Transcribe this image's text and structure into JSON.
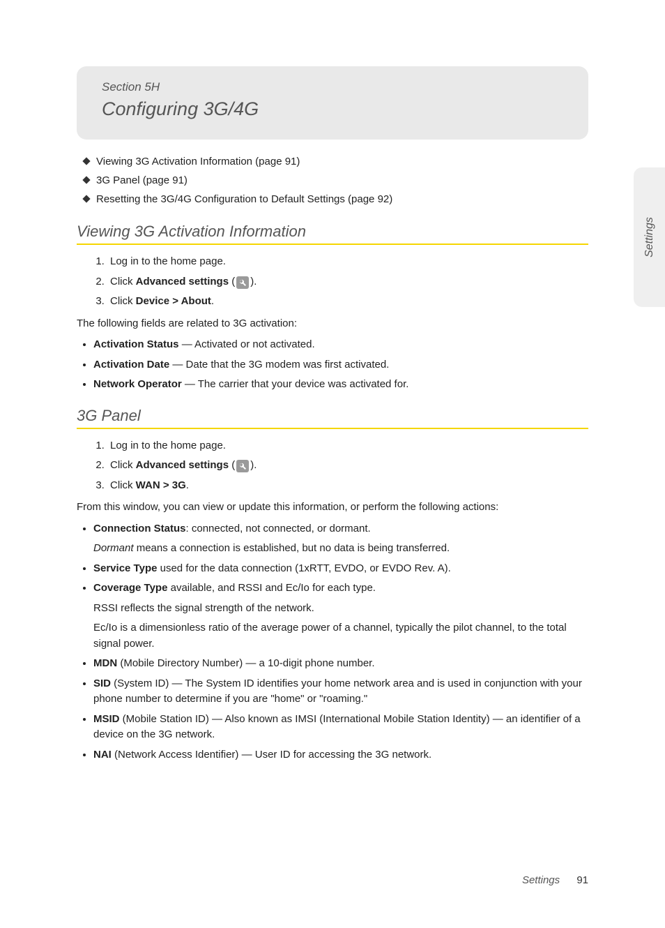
{
  "sideTab": "Settings",
  "header": {
    "sectionLabel": "Section 5H",
    "title": "Configuring 3G/4G"
  },
  "toc": [
    "Viewing 3G Activation Information (page 91)",
    "3G Panel (page 91)",
    "Resetting the 3G/4G Configuration to Default Settings (page 92)"
  ],
  "sectionA": {
    "heading": "Viewing 3G Activation Information",
    "steps": {
      "s1": "Log in to the home page.",
      "s2_prefix": "Click ",
      "s2_bold": "Advanced settings",
      "s2_paren_open": " (",
      "s2_paren_close": ").",
      "s3_prefix": "Click ",
      "s3_bold": "Device > About",
      "s3_suffix": "."
    },
    "intro": "The following fields are related to 3G activation:",
    "bullets": {
      "b1_bold": "Activation Status",
      "b1_rest": " — Activated or not activated.",
      "b2_bold": "Activation Date",
      "b2_rest": " — Date that the 3G modem was first activated.",
      "b3_bold": "Network Operator",
      "b3_rest": " — The carrier that your device was activated for."
    }
  },
  "sectionB": {
    "heading": "3G Panel",
    "steps": {
      "s1": "Log in to the home page.",
      "s2_prefix": "Click ",
      "s2_bold": "Advanced settings",
      "s2_paren_open": " (",
      "s2_paren_close": ").",
      "s3_prefix": "Click ",
      "s3_bold": "WAN > 3G",
      "s3_suffix": "."
    },
    "intro": "From this window, you can view or update this information, or perform the following actions:",
    "bullets": {
      "b1_bold": "Connection Status",
      "b1_rest": ": connected, not connected, or dormant.",
      "b1_note_em": "Dormant",
      "b1_note_rest": " means a connection is established, but no data is being transferred.",
      "b2_bold": "Service Type",
      "b2_rest": " used for the data connection (1xRTT, EVDO, or EVDO Rev. A).",
      "b3_bold": "Coverage Type",
      "b3_rest": " available, and RSSI and Ec/Io for each type.",
      "b3_note1": "RSSI reflects the signal strength of the network.",
      "b3_note2": "Ec/Io is a dimensionless ratio of the average power of a channel, typically the pilot channel, to the total signal power.",
      "b4_bold": "MDN",
      "b4_rest": " (Mobile Directory Number) — a 10-digit phone number.",
      "b5_bold": "SID",
      "b5_rest": " (System ID) — The System ID identifies your home network area and is used in conjunction with your phone number to determine if you are \"home\" or \"roaming.\"",
      "b6_bold": "MSID",
      "b6_rest": " (Mobile Station ID) — Also known as IMSI (International Mobile Station Identity) — an identifier of a device on the 3G network.",
      "b7_bold": "NAI",
      "b7_rest": " (Network Access Identifier) — User ID for accessing the 3G network."
    }
  },
  "footer": {
    "chapter": "Settings",
    "page": "91"
  }
}
